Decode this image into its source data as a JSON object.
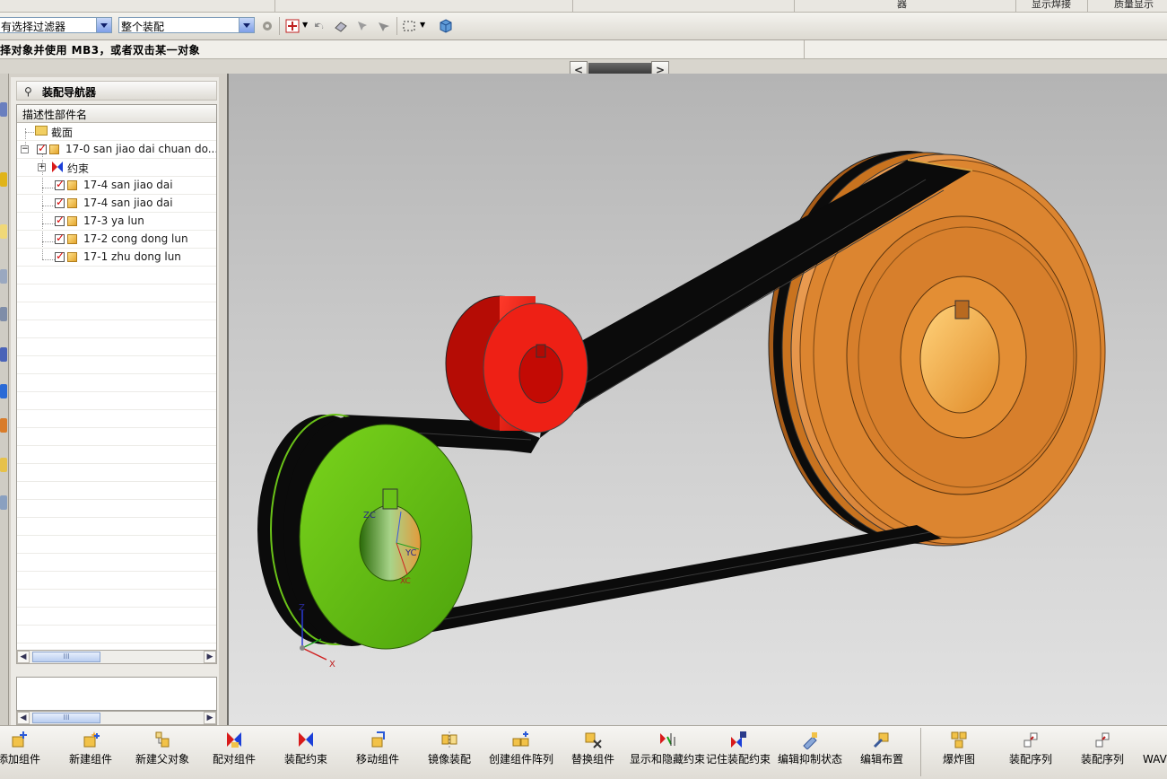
{
  "top_strip": {
    "labels": [
      "器",
      "显示焊接",
      "质量显示"
    ]
  },
  "selection_bar": {
    "filter_value": "有选择过滤器",
    "scope_value": "整个装配"
  },
  "cue_line": {
    "text": "择对象并使用 MB3，或者双击某一对象"
  },
  "scroll_arrows": {
    "left": "<",
    "right": ">"
  },
  "navigator": {
    "title": "装配导航器",
    "column_header": "描述性部件名",
    "nodes": [
      {
        "label": "截面",
        "kind": "folder"
      },
      {
        "label": "17-0 san jiao dai chuan do...",
        "kind": "assembly",
        "checked": true
      },
      {
        "label": "约束",
        "kind": "constraints"
      },
      {
        "label": "17-4 san jiao dai",
        "kind": "part",
        "checked": true
      },
      {
        "label": "17-4 san jiao dai",
        "kind": "part",
        "checked": true
      },
      {
        "label": "17-3 ya lun",
        "kind": "part",
        "checked": true
      },
      {
        "label": "17-2 cong dong lun",
        "kind": "part",
        "checked": true
      },
      {
        "label": "17-1 zhu dong lun",
        "kind": "part",
        "checked": true
      }
    ],
    "scroll_glyph": "III"
  },
  "viewport": {
    "axis_labels": {
      "z": "Z",
      "x": "X",
      "zc": "ZC",
      "yc": "YC",
      "xc": "XC"
    },
    "colors": {
      "idler": "#e81c0f",
      "small_pulley": "#5fbf10",
      "large_pulley": "#d98432",
      "belt": "#0b0b0b"
    }
  },
  "bottom_toolbar": {
    "tools": [
      {
        "label": "添加组件",
        "icon": "add-component-icon"
      },
      {
        "label": "新建组件",
        "icon": "new-component-icon"
      },
      {
        "label": "新建父对象",
        "icon": "new-parent-icon"
      },
      {
        "label": "配对组件",
        "icon": "mate-component-icon"
      },
      {
        "label": "装配约束",
        "icon": "assembly-constraint-icon"
      },
      {
        "label": "移动组件",
        "icon": "move-component-icon"
      },
      {
        "label": "镜像装配",
        "icon": "mirror-assembly-icon"
      },
      {
        "label": "创建组件阵列",
        "icon": "component-array-icon"
      },
      {
        "label": "替换组件",
        "icon": "replace-component-icon"
      },
      {
        "label": "显示和隐藏约束",
        "icon": "show-hide-constraints-icon"
      },
      {
        "label": "记住装配约束",
        "icon": "remember-constraints-icon"
      },
      {
        "label": "编辑抑制状态",
        "icon": "edit-suppression-icon"
      },
      {
        "label": "编辑布置",
        "icon": "edit-arrangement-icon"
      },
      {
        "label": "爆炸图",
        "icon": "exploded-view-icon"
      },
      {
        "label": "装配序列",
        "icon": "assembly-sequence-icon"
      },
      {
        "label": "装配序列",
        "icon": "assembly-sequence-icon"
      },
      {
        "label": "WAVE 链",
        "icon": "wave-link-icon"
      }
    ]
  }
}
